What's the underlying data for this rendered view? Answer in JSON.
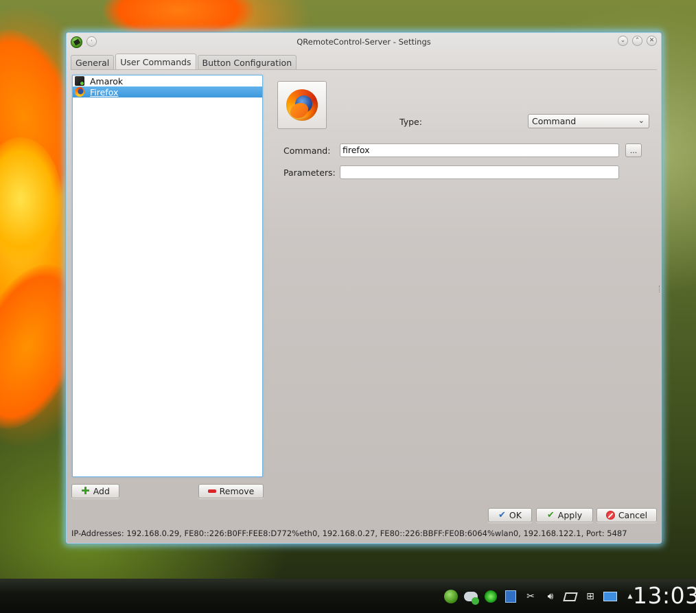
{
  "window": {
    "title": "QRemoteControl-Server - Settings",
    "titlebar_buttons": [
      "minimize",
      "maximize",
      "close"
    ]
  },
  "tabs": [
    {
      "label": "General",
      "active": false
    },
    {
      "label": "User Commands",
      "active": true
    },
    {
      "label": "Button Configuration",
      "active": false
    }
  ],
  "commands_list": {
    "items": [
      {
        "label": "Amarok",
        "icon": "amarok-icon",
        "selected": false
      },
      {
        "label": "Firefox",
        "icon": "firefox-icon",
        "selected": true
      }
    ],
    "add_label": "Add",
    "remove_label": "Remove"
  },
  "editor": {
    "icon": "firefox-icon",
    "type_label": "Type:",
    "type_value": "Command",
    "command_label": "Command:",
    "command_value": "firefox",
    "browse_label": "...",
    "parameters_label": "Parameters:",
    "parameters_value": ""
  },
  "dialog_buttons": {
    "ok": "OK",
    "apply": "Apply",
    "cancel": "Cancel"
  },
  "status_text": "IP-Addresses: 192.168.0.29, FE80::226:B0FF:FEE8:D772%eth0, 192.168.0.27, FE80::226:BBFF:FE0B:6064%wlan0, 192.168.122.1, Port: 5487",
  "taskbar": {
    "tray_icons": [
      "qremotecontrol-icon",
      "cloud-sync-icon",
      "green-status-icon",
      "clipboard-icon",
      "scissors-icon",
      "volume-icon",
      "tablet-icon",
      "network-icon",
      "display-icon",
      "expand-tray-icon"
    ],
    "clock": "13:03"
  },
  "colors": {
    "selection": "#3e98dc",
    "window_glow": "#82d2ff",
    "remove_icon": "#d8262a",
    "add_icon": "#3a9c22"
  }
}
